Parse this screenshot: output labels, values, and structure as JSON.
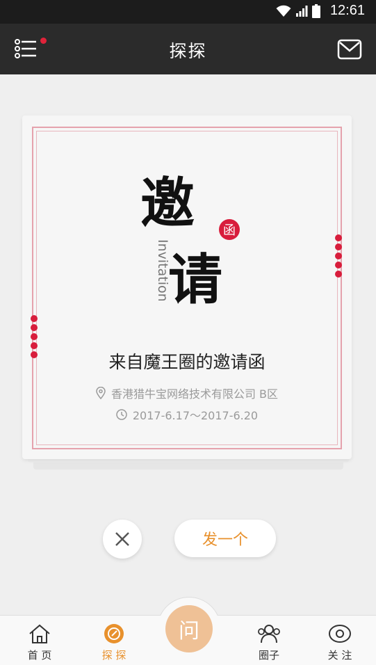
{
  "status_bar": {
    "time": "12:61"
  },
  "header": {
    "title": "探探"
  },
  "invitation": {
    "title": "来自魔王圈的邀请函",
    "location": "香港猎牛宝网络技术有限公司 B区",
    "date_range": "2017-6.17～2017-6.20",
    "calligraphy_char1": "邀",
    "calligraphy_char2": "请",
    "seal_char": "函",
    "english_word": "Invitation"
  },
  "actions": {
    "send_label": "发一个"
  },
  "tabs": [
    {
      "label": "首 页",
      "icon": "home-icon"
    },
    {
      "label": "探 探",
      "icon": "compass-icon"
    },
    {
      "label": "问",
      "icon": "ask-icon"
    },
    {
      "label": "圈子",
      "icon": "group-icon"
    },
    {
      "label": "关 注",
      "icon": "eye-icon"
    }
  ],
  "colors": {
    "accent": "#e8912d",
    "seal_red": "#d81d3c",
    "header_bg": "#2b2b2b"
  }
}
